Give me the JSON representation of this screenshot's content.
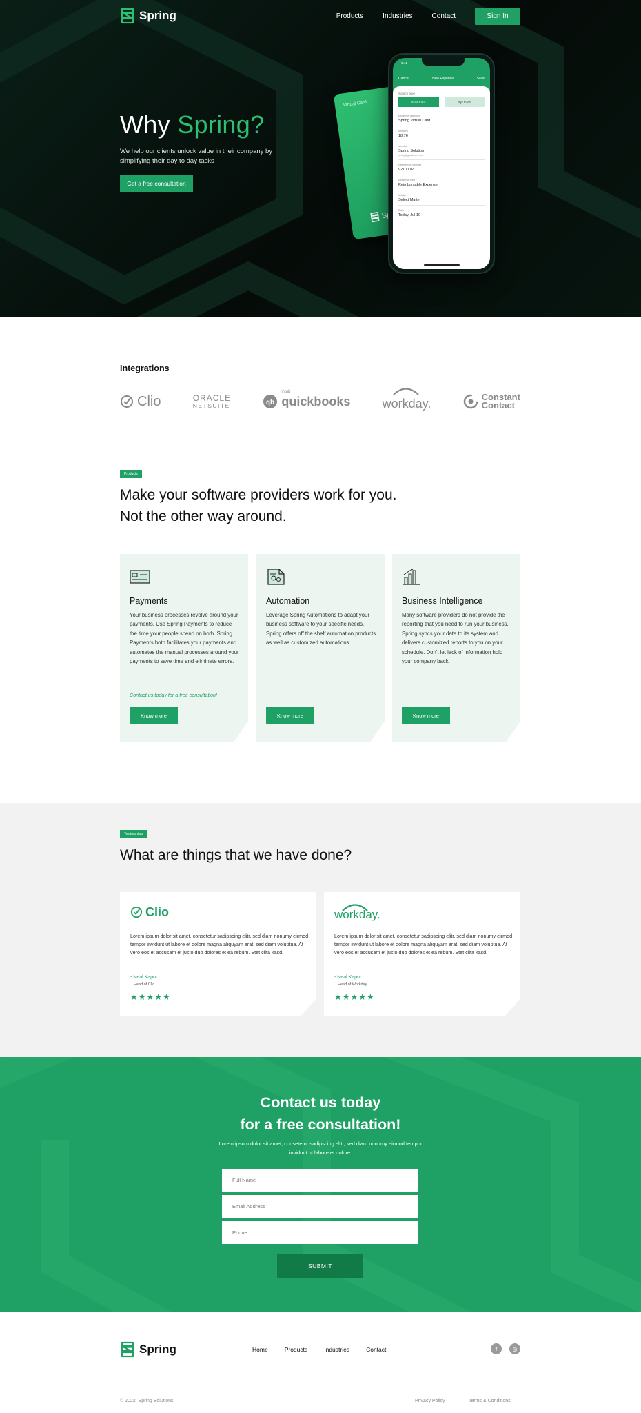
{
  "brand": {
    "name": "Spring",
    "accent_color": "#1fa065",
    "dark_bg": "#050b08"
  },
  "nav": {
    "links": [
      "Products",
      "Industries",
      "Contact"
    ],
    "signin_label": "Sign In"
  },
  "hero": {
    "title_prefix": "Why ",
    "title_accent": "Spring?",
    "subtitle": "We help our clients unlock value in their company by simplifying their day to day tasks",
    "cta_label": "Get a free consultation",
    "card_label": "Virtual Card",
    "card_brand": "Spri",
    "phone": {
      "time": "9:41",
      "cancel": "Cancel",
      "header_title": "New Expense",
      "save": "Save",
      "source_label": "Source type",
      "tab_a": "Fred Card",
      "tab_b": "Spl Card",
      "fields": [
        {
          "k": "Expense category",
          "v": "Spring Virtual Card",
          "s": ""
        },
        {
          "k": "Amount",
          "v": "18.76",
          "s": ""
        },
        {
          "k": "Vendor",
          "v": "Spring Solution",
          "s": "spring@gsolutions.com"
        },
        {
          "k": "Reference number",
          "v": "921000VC",
          "s": ""
        },
        {
          "k": "Expense type",
          "v": "Reimbursable Expense",
          "s": ""
        },
        {
          "k": "Matter",
          "v": "Select Matter",
          "s": ""
        },
        {
          "k": "Date",
          "v": "Today, Jul 10",
          "s": ""
        }
      ]
    }
  },
  "integrations": {
    "title": "Integrations",
    "logos": [
      {
        "icon": "clio-check-icon",
        "text": "Clio"
      },
      {
        "icon": "",
        "text": "ORACLE",
        "sub": "NETSUITE"
      },
      {
        "icon": "quickbooks-icon",
        "text": "quickbooks",
        "sup": "intuit"
      },
      {
        "icon": "workday-arc-icon",
        "text": "workday."
      },
      {
        "icon": "constant-contact-icon",
        "text": "Constant",
        "sub": "Contact"
      }
    ]
  },
  "products": {
    "tag": "Products",
    "title_line1": "Make your software providers work for you.",
    "title_line2": "Not the other way around.",
    "cards": [
      {
        "icon": "payment-card-icon",
        "title": "Payments",
        "text": "Your business processes revolve around your payments. Use Spring Payments to reduce the time your people spend on both. Spring Payments both facilitates your payments and automates the manual processes around your payments to save time and eliminate errors.",
        "note": "Contact us today for a free consultation!",
        "button": "Know more"
      },
      {
        "icon": "automation-document-icon",
        "title": "Automation",
        "text": "Leverage Spring Automations to adapt your business software to your specific needs. Spring offers off the shelf automation products as well as customized automations.",
        "note": "",
        "button": "Know more"
      },
      {
        "icon": "bar-chart-icon",
        "title": "Business Intelligence",
        "text": "Many software providers do not provide the reporting that you need to run your business. Spring syncs your data to its system and delivers customized reports to you on your schedule. Don't let lack of information hold your company back.",
        "note": "",
        "button": "Know more"
      }
    ]
  },
  "testimonials": {
    "tag": "Testimonials",
    "title": "What are things that we have done?",
    "items": [
      {
        "logo": "Clio",
        "text": "Lorem ipsum dolor sit amet, consetetur sadipscing elitr, sed diam nonumy eirmod tempor invidunt ut labore et dolore magna aliquyam erat, sed diam voluptua. At vero eos et accusam et justo duo dolores et ea rebum. Stet clita kasd.",
        "name": "- Neal Kapur",
        "role": "Head of Clio",
        "stars": "★★★★★"
      },
      {
        "logo": "workday.",
        "text": "Lorem ipsum dolor sit amet, consetetur sadipscing elitr, sed diam nonumy eirmod tempor invidunt ut labore et dolore magna aliquyam erat, sed diam voluptua. At vero eos et accusam et justo duo dolores et ea rebum. Stet clita kasd.",
        "name": "- Neal Kapur",
        "role": "Head of Workday",
        "stars": "★★★★★"
      }
    ]
  },
  "contact": {
    "title_line1": "Contact us today",
    "title_line2": "for a free consultation!",
    "subtitle": "Lorem ipsum dolor sit amet, consetetur sadipscing elitr, sed diam nonumy eirmod tempor invidunt ut labore et dolore.",
    "placeholders": {
      "name": "Full Name",
      "email": "Email Address",
      "phone": "Phone"
    },
    "submit_label": "SUBMIT"
  },
  "footer": {
    "links": [
      "Home",
      "Products",
      "Industries",
      "Contact"
    ],
    "social": [
      {
        "icon": "facebook-icon",
        "glyph": "f"
      },
      {
        "icon": "instagram-icon",
        "glyph": "◎"
      }
    ],
    "copyright": "© 2022. Spring Solutions.",
    "privacy": "Privacy Policy",
    "terms": "Terms & Conditions"
  }
}
